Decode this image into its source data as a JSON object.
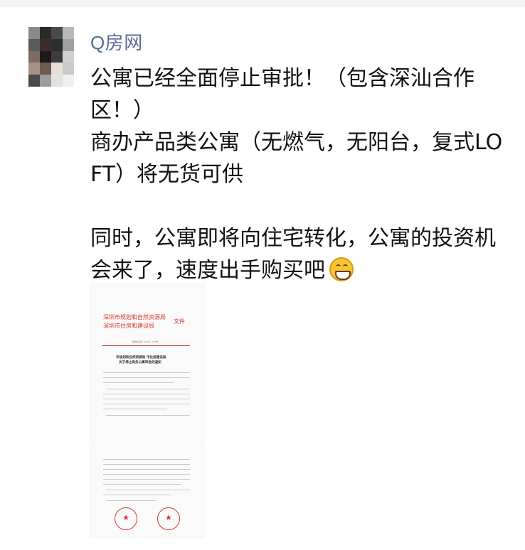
{
  "sender": {
    "name": "Q房网"
  },
  "message": {
    "paragraph1": "公寓已经全面停止审批！（包含深汕合作区！）",
    "paragraph2": "商办产品类公寓（无燃气，无阳台，复式LOFT）将无货可供",
    "paragraph3": "同时，公寓即将向住宅转化，公寓的投资机会来了，速度出手购买吧",
    "emoji": "grinning-face-emoji"
  },
  "document": {
    "issuer_line1": "深圳市规划和自然资源局",
    "issuer_line2": "深圳市住房和建设局",
    "issuer_suffix": "文件",
    "doc_number": "深规划资源〔2020〕208号",
    "title_line1": "市规划和自然资源局 市住房建设局",
    "title_line2": "关于停止商务公寓审批的通知"
  },
  "colors": {
    "name": "#576b95",
    "text": "#111111",
    "doc_red": "#d23a36"
  }
}
